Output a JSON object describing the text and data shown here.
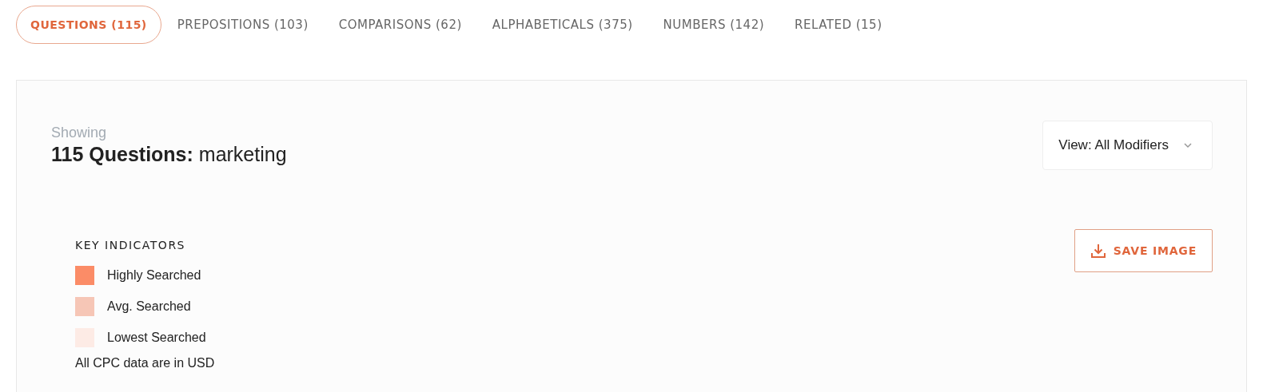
{
  "tabs": [
    {
      "label": "QUESTIONS (115)",
      "selected": true
    },
    {
      "label": "PREPOSITIONS (103)",
      "selected": false
    },
    {
      "label": "COMPARISONS (62)",
      "selected": false
    },
    {
      "label": "ALPHABETICALS (375)",
      "selected": false
    },
    {
      "label": "NUMBERS (142)",
      "selected": false
    },
    {
      "label": "RELATED (15)",
      "selected": false
    }
  ],
  "showing": "Showing",
  "heading": "**115 Questions:** marketing",
  "view_dropdown": {
    "value": "View: All Modifiers"
  },
  "key_indicators": {
    "title": "KEY INDICATORS",
    "items": [
      {
        "label": "Highly Searched",
        "color": "#fb8c67"
      },
      {
        "label": "Avg. Searched",
        "color": "#f6c6b6"
      },
      {
        "label": "Lowest Searched",
        "color": "#fdebe5"
      }
    ],
    "note": "All CPC data are in USD"
  },
  "save_button": "SAVE IMAGE"
}
